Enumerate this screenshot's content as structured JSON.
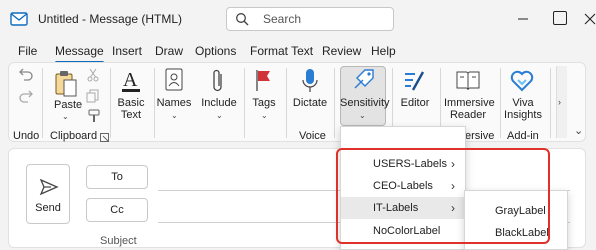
{
  "window": {
    "title": "Untitled  -  Message (HTML)"
  },
  "search": {
    "placeholder": "Search"
  },
  "tabs": [
    "File",
    "Message",
    "Insert",
    "Draw",
    "Options",
    "Format Text",
    "Review",
    "Help"
  ],
  "ribbon": {
    "undo_group": "Undo",
    "paste": "Paste",
    "clipboard_group": "Clipboard",
    "basic_text": [
      "Basic",
      "Text"
    ],
    "names": "Names",
    "include": "Include",
    "tags": "Tags",
    "dictate": "Dictate",
    "voice_group": "Voice",
    "sensitivity": "Sensitivity",
    "editor": "Editor",
    "immersive_reader": [
      "Immersive",
      "Reader"
    ],
    "immersive_group_partial": "ersive",
    "viva": [
      "Viva",
      "Insights"
    ],
    "addin_group": "Add-in"
  },
  "compose": {
    "send": "Send",
    "to": "To",
    "cc": "Cc",
    "subject": "Subject"
  },
  "sensitivity_menu": {
    "items": [
      "USERS-Labels",
      "CEO-Labels",
      "IT-Labels",
      "NoColorLabel"
    ],
    "submenu": [
      "GrayLabel",
      "BlackLabel"
    ]
  },
  "colors": {
    "accent": "#0f6cbd",
    "highlight_box": "#e0302a",
    "flag_red": "#d13438"
  }
}
